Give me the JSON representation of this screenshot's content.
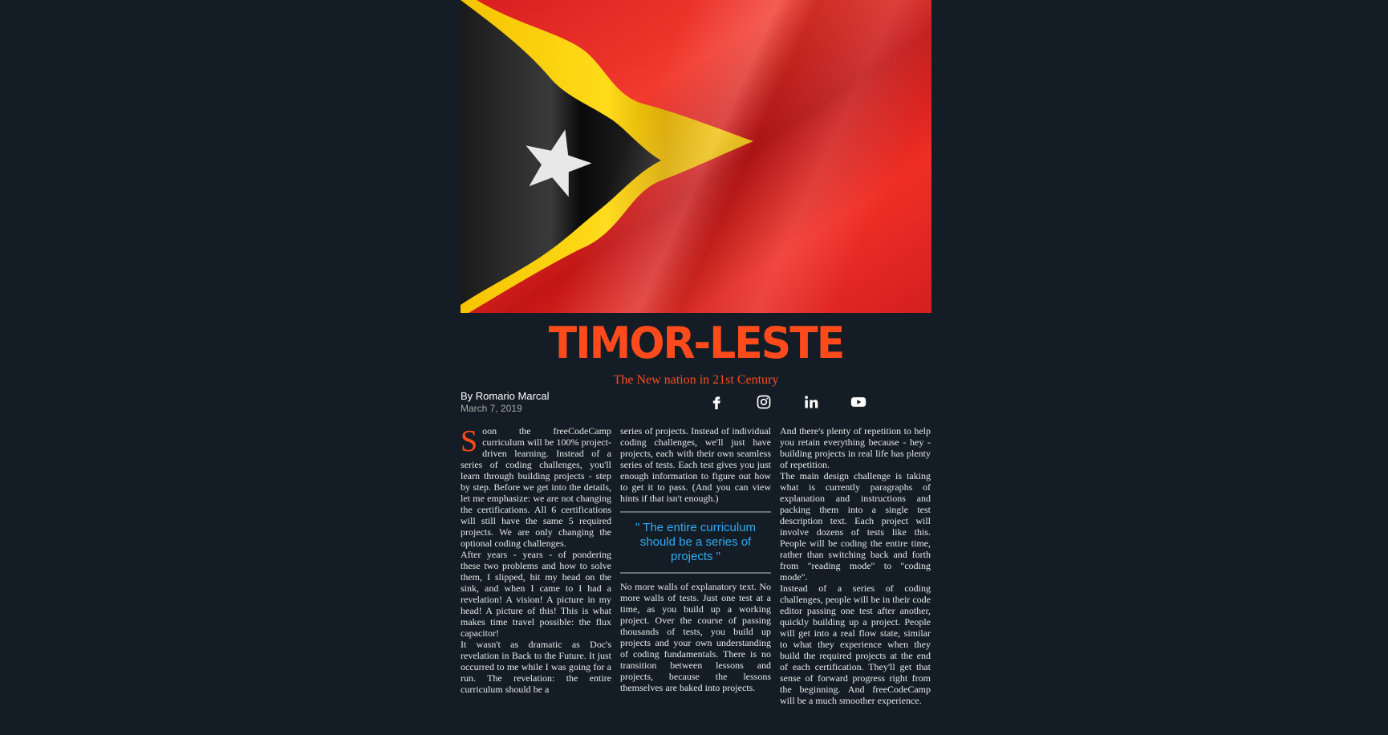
{
  "article": {
    "title": "TIMOR-LESTE",
    "subtitle": "The New nation in 21st Century",
    "byline": "By Romario Marcal",
    "date": "March 7, 2019"
  },
  "social": {
    "icons": [
      "facebook-icon",
      "instagram-icon",
      "linkedin-icon",
      "youtube-icon"
    ]
  },
  "colors": {
    "background": "#141d26",
    "accent": "#ff4a1c",
    "quote": "#33aaf0"
  },
  "body": {
    "dropcap": "S",
    "col1_p1": "oon the freeCodeCamp curriculum will be 100% project-driven learning. Instead of a series of coding challenges, you'll learn through building projects - step by step. Before we get into the details, let me emphasize: we are not changing the certifications. All 6 certifications will still have the same 5 required projects. We are only changing the optional coding challenges.",
    "col1_p2": "After years - years - of pondering these two problems and how to solve them, I slipped, hit my head on the sink, and when I came to I had a revelation! A vision! A picture in my head! A picture of this! This is what makes time travel possible: the flux capacitor!",
    "col1_p3": "It wasn't as dramatic as Doc's revelation in Back to the Future. It just occurred to me while I was going for a run. The revelation: the entire curriculum should be a",
    "col2_p1": "series of projects. Instead of individual coding challenges, we'll just have projects, each with their own seamless series of tests. Each test gives you just enough information to figure out how to get it to pass. (And you can view hints if that isn't enough.)",
    "quote": "\" The entire curriculum should be a series of projects \"",
    "col2_p2": "No more walls of explanatory text. No more walls of tests. Just one test at a time, as you build up a working project. Over the course of passing thousands of tests, you build up projects and your own understanding of coding fundamentals. There is no transition between lessons and projects, because the lessons themselves are baked into projects.",
    "col3_p1": "And there's plenty of repetition to help you retain everything because - hey - building projects in real life has plenty of repetition.",
    "col3_p2": "The main design challenge is taking what is currently paragraphs of explanation and instructions and packing them into a single test description text. Each project will involve dozens of tests like this. People will be coding the entire time, rather than switching back and forth from \"reading mode\" to \"coding mode\".",
    "col3_p3": "Instead of a series of coding challenges, people will be in their code editor passing one test after another, quickly building up a project. People will get into a real flow state, similar to what they experience when they build the required projects at the end of each certification. They'll get that sense of forward progress right from the beginning. And freeCodeCamp will be a much smoother experience."
  }
}
